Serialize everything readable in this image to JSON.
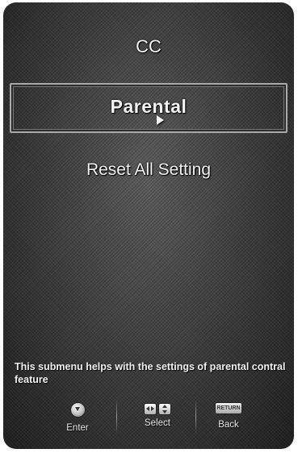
{
  "menu": {
    "items": [
      {
        "label": "CC"
      },
      {
        "label": "Parental",
        "selected": true
      },
      {
        "label": "Reset All Setting"
      }
    ]
  },
  "help": {
    "text": "This submenu helps with the settings of parental contral feature"
  },
  "controls": {
    "enter": {
      "label": "Enter",
      "icon": "ok-button-icon"
    },
    "select": {
      "label": "Select",
      "icon": "arrow-keys-icon"
    },
    "back": {
      "label": "Back",
      "icon": "return-button-icon",
      "icon_text": "RETURN"
    }
  },
  "colors": {
    "background": "#3a3a3a",
    "text": "#f4f4f4",
    "highlight_border": "#a9a9a9"
  }
}
